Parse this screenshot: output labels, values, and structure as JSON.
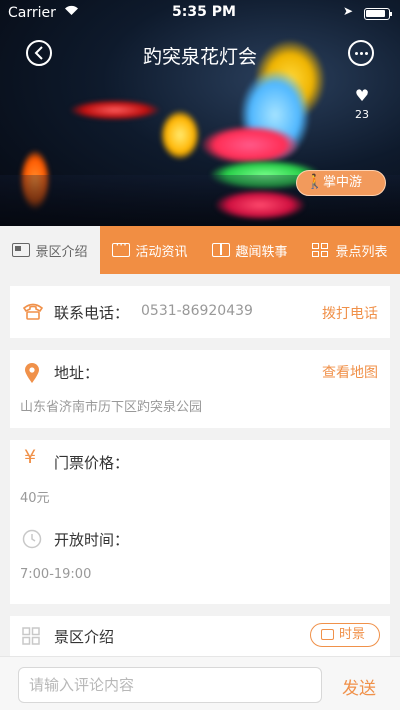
{
  "status_bar": {
    "carrier": "Carrier",
    "time": "5:35 PM"
  },
  "nav": {
    "title": "趵突泉花灯会"
  },
  "hero": {
    "like_count": "23",
    "guide_button": "掌中游"
  },
  "tabs": [
    {
      "label": "景区介绍",
      "icon": "id-card-icon",
      "active": true
    },
    {
      "label": "活动资讯",
      "icon": "chat-icon",
      "active": false
    },
    {
      "label": "趣闻轶事",
      "icon": "book-icon",
      "active": false
    },
    {
      "label": "景点列表",
      "icon": "grid-icon",
      "active": false
    }
  ],
  "phone": {
    "label": "联系电话：",
    "number": "0531-86920439",
    "action": "拨打电话"
  },
  "address": {
    "label": "地址：",
    "action": "查看地图",
    "value": "山东省济南市历下区趵突泉公园"
  },
  "ticket": {
    "label": "门票价格：",
    "value": "40元"
  },
  "hours": {
    "label": "开放时间：",
    "value": "7:00-19:00"
  },
  "intro": {
    "label": "景区介绍",
    "time_button": "时景"
  },
  "footer": {
    "placeholder": "请输入评论内容",
    "send": "发送"
  },
  "colors": {
    "accent": "#f0914a",
    "tab_bar": "#f18e43"
  }
}
